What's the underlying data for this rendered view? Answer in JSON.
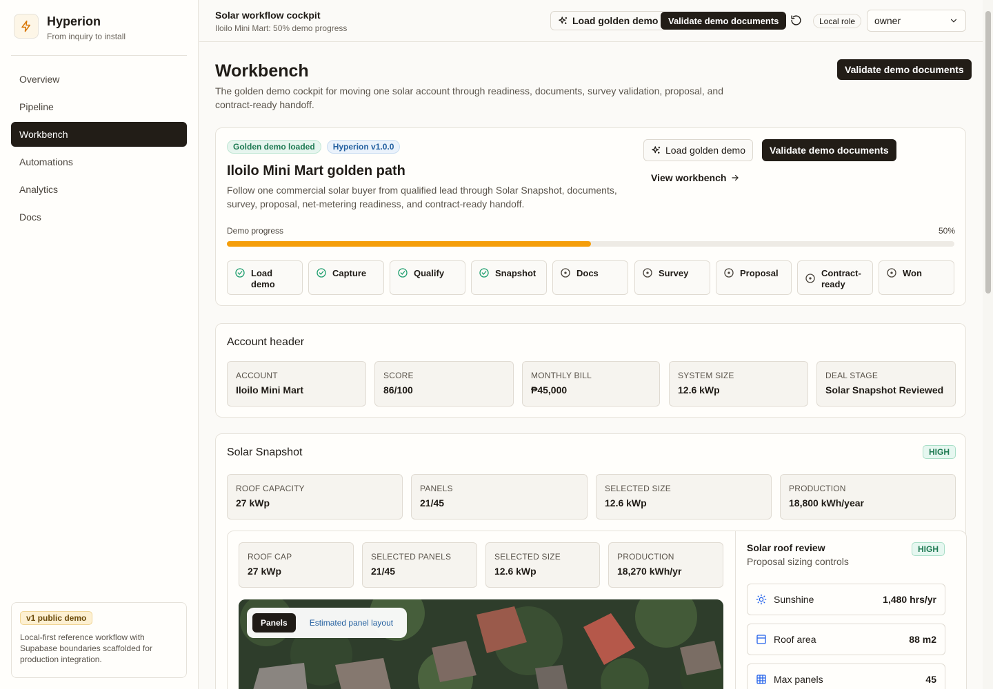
{
  "brand": {
    "name": "Hyperion",
    "tagline": "From inquiry to install"
  },
  "nav": [
    {
      "label": "Overview"
    },
    {
      "label": "Pipeline"
    },
    {
      "label": "Workbench",
      "active": true
    },
    {
      "label": "Automations"
    },
    {
      "label": "Analytics"
    },
    {
      "label": "Docs"
    }
  ],
  "sidebar_card": {
    "badge": "v1 public demo",
    "text": "Local-first reference workflow with Supabase boundaries scaffolded for production integration."
  },
  "topbar": {
    "title": "Solar workflow cockpit",
    "subtitle": "Iloilo Mini Mart: 50% demo progress",
    "load_label": "Load golden demo",
    "validate_label": "Validate demo documents",
    "role_label": "Local role",
    "role_value": "owner"
  },
  "page": {
    "title": "Workbench",
    "description": "The golden demo cockpit for moving one solar account through readiness, documents, survey validation, proposal, and contract-ready handoff.",
    "validate_label": "Validate demo documents"
  },
  "demo_card": {
    "badges": [
      "Golden demo loaded",
      "Hyperion v1.0.0"
    ],
    "title": "Iloilo Mini Mart golden path",
    "description": "Follow one commercial solar buyer from qualified lead through Solar Snapshot, documents, survey, proposal, net-metering readiness, and contract-ready handoff.",
    "load_label": "Load golden demo",
    "validate_label": "Validate demo documents",
    "view_label": "View workbench",
    "progress_label": "Demo progress",
    "progress_text": "50%",
    "progress_value": 0.5,
    "steps": [
      {
        "label": "Load demo",
        "done": true
      },
      {
        "label": "Capture",
        "done": true
      },
      {
        "label": "Qualify",
        "done": true
      },
      {
        "label": "Snapshot",
        "done": true
      },
      {
        "label": "Docs",
        "done": false
      },
      {
        "label": "Survey",
        "done": false
      },
      {
        "label": "Proposal",
        "done": false
      },
      {
        "label": "Contract-ready",
        "done": false
      },
      {
        "label": "Won",
        "done": false
      }
    ]
  },
  "account": {
    "title": "Account header",
    "metrics": [
      {
        "label": "Account",
        "value": "Iloilo Mini Mart"
      },
      {
        "label": "Score",
        "value": "86/100"
      },
      {
        "label": "Monthly bill",
        "value": "₱45,000"
      },
      {
        "label": "System size",
        "value": "12.6 kWp"
      },
      {
        "label": "Deal stage",
        "value": "Solar Snapshot Reviewed"
      }
    ]
  },
  "snapshot": {
    "title": "Solar Snapshot",
    "badge": "HIGH",
    "metrics": [
      {
        "label": "Roof capacity",
        "value": "27 kWp"
      },
      {
        "label": "Panels",
        "value": "21/45"
      },
      {
        "label": "Selected size",
        "value": "12.6 kWp"
      },
      {
        "label": "Production",
        "value": "18,800 kWh/year"
      }
    ],
    "inner_metrics": [
      {
        "label": "Roof cap",
        "value": "27 kWp"
      },
      {
        "label": "Selected panels",
        "value": "21/45"
      },
      {
        "label": "Selected size",
        "value": "12.6 kWp"
      },
      {
        "label": "Production",
        "value": "18,270 kWh/yr"
      }
    ],
    "map": {
      "toggle_label": "Panels",
      "link_label": "Estimated panel layout"
    },
    "review": {
      "title": "Solar roof review",
      "subtitle": "Proposal sizing controls",
      "badge": "HIGH",
      "stats": [
        {
          "label": "Sunshine",
          "value": "1,480 hrs/yr",
          "icon": "sun-icon"
        },
        {
          "label": "Roof area",
          "value": "88 m2",
          "icon": "roof-area-icon"
        },
        {
          "label": "Max panels",
          "value": "45",
          "icon": "grid-icon"
        }
      ]
    }
  },
  "colors": {
    "accent": "#f59e0b",
    "dark": "#221d17",
    "success": "#1e7a52"
  }
}
